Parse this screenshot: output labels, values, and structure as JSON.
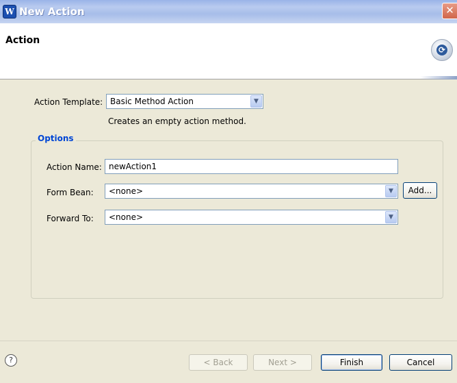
{
  "window": {
    "title": "New Action",
    "close_glyph": "✕",
    "app_icon_glyph": "W",
    "icon": "app-logo-icon"
  },
  "banner": {
    "title": "Action",
    "icon": "refresh-icon",
    "icon_glyph": "⟳"
  },
  "action_template": {
    "label": "Action Template:",
    "value": "Basic Method Action",
    "description": "Creates an empty action method."
  },
  "options": {
    "legend": "Options",
    "action_name": {
      "label": "Action Name:",
      "value": "newAction1"
    },
    "form_bean": {
      "label": "Form Bean:",
      "value": "<none>",
      "add_label": "Add..."
    },
    "forward_to": {
      "label": "Forward To:",
      "value": "<none>"
    }
  },
  "footer": {
    "help_glyph": "?",
    "back_label": "< Back",
    "next_label": "Next >",
    "finish_label": "Finish",
    "cancel_label": "Cancel"
  },
  "colors": {
    "title_bar": "#a7bde9",
    "legend": "#0046d5",
    "dialog_bg": "#ece9d8",
    "close_button": "#d0664b"
  }
}
